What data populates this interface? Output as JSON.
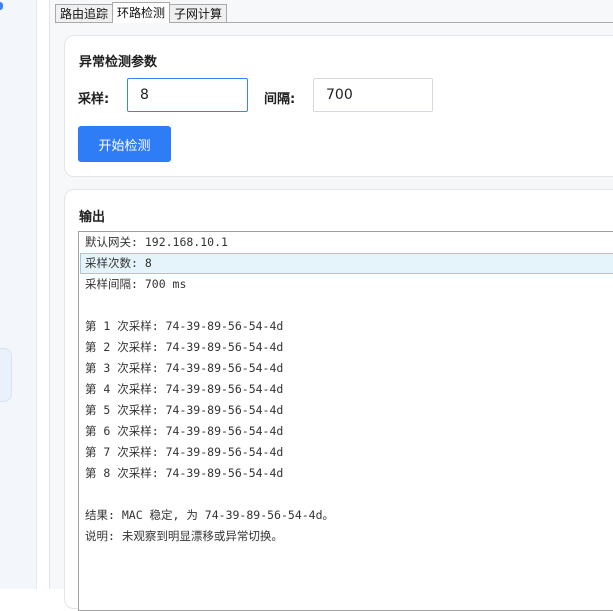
{
  "tabs": [
    {
      "label": "路由追踪"
    },
    {
      "label": "环路检测"
    },
    {
      "label": "子网计算"
    }
  ],
  "active_tab": "环路检测",
  "params": {
    "title": "异常检测参数",
    "samples_label": "采样:",
    "samples_value": "8",
    "interval_label": "间隔:",
    "interval_value": "700",
    "start_button": "开始检测"
  },
  "output": {
    "title": "输出",
    "lines": [
      "默认网关: 192.168.10.1",
      "采样次数: 8",
      "采样间隔: 700 ms",
      "",
      "第 1 次采样: 74-39-89-56-54-4d",
      "第 2 次采样: 74-39-89-56-54-4d",
      "第 3 次采样: 74-39-89-56-54-4d",
      "第 4 次采样: 74-39-89-56-54-4d",
      "第 5 次采样: 74-39-89-56-54-4d",
      "第 6 次采样: 74-39-89-56-54-4d",
      "第 7 次采样: 74-39-89-56-54-4d",
      "第 8 次采样: 74-39-89-56-54-4d",
      "",
      "结果: MAC 稳定, 为 74-39-89-56-54-4d。",
      "说明: 未观察到明显漂移或异常切换。"
    ],
    "highlighted_line": 1
  },
  "colors": {
    "accent": "#2f7df6",
    "focus_border": "#3b82f6",
    "highlight_bg": "#e5f3fb"
  }
}
